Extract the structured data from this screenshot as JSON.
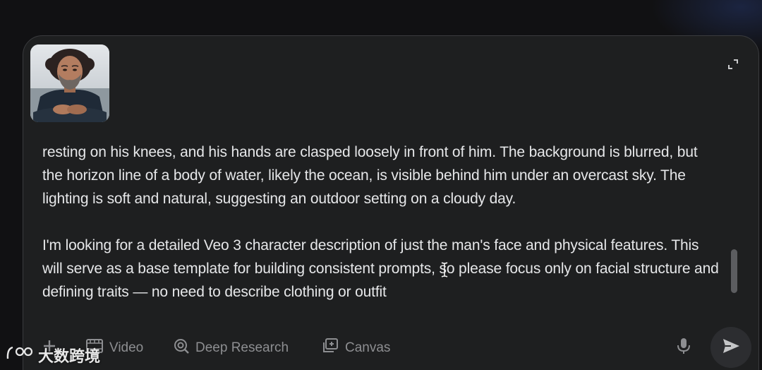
{
  "prompt": {
    "paragraphs": [
      "resting on his knees, and his hands are clasped loosely in front of him. The background is blurred, but the horizon line of a body of water, likely the ocean, is visible behind him under an overcast sky. The lighting is soft and natural, suggesting an outdoor setting on a cloudy day.",
      "I'm looking for a detailed Veo 3 character description of just the man's face and physical features. This will serve as a base template for building consistent prompts, so please focus only on facial structure and defining traits — no need to describe clothing or outfit"
    ],
    "attachment_icon": "photo-thumbnail"
  },
  "toolbar": {
    "add_icon": "plus-icon",
    "video_label": "Video",
    "video_icon": "film-icon",
    "research_label": "Deep Research",
    "research_icon": "deep-research-icon",
    "canvas_label": "Canvas",
    "canvas_icon": "canvas-icon",
    "mic_icon": "microphone-icon",
    "send_icon": "send-icon",
    "expand_icon": "expand-icon"
  },
  "watermark": {
    "text": "大数跨境"
  },
  "colors": {
    "background": "#111113",
    "box": "#1e1f20",
    "text": "#e6e7e9",
    "muted": "#8d8e91"
  }
}
